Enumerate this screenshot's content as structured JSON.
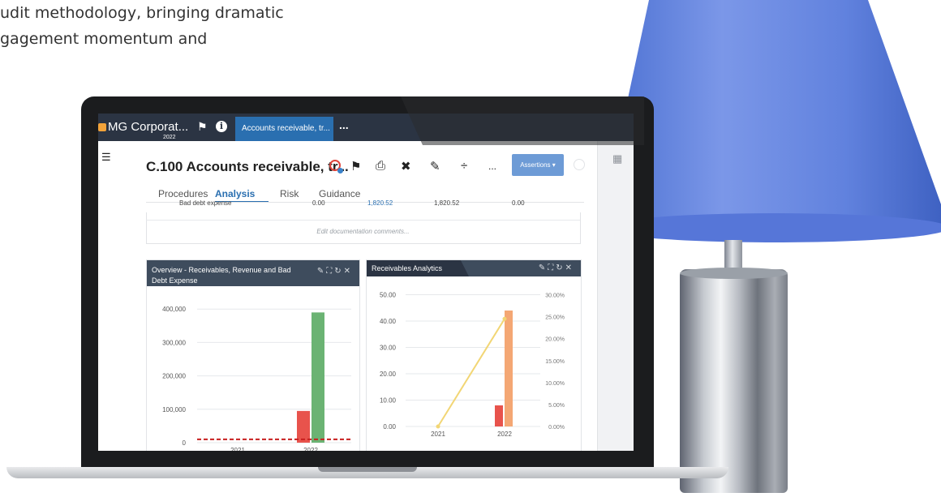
{
  "marketing": {
    "line1": "udit methodology, bringing dramatic",
    "line2": "gagement momentum and"
  },
  "topbar": {
    "org_name": "MG Corporat...",
    "org_year": "2022",
    "active_tab": "Accounts receivable, tr...",
    "more": "..."
  },
  "header": {
    "title": "C.100 Accounts receivable, tr...",
    "assertions_label": "Assertions ▾",
    "more_label": "..."
  },
  "tabs": [
    {
      "label": "Procedures"
    },
    {
      "label": "Analysis"
    },
    {
      "label": "Risk"
    },
    {
      "label": "Guidance"
    }
  ],
  "table_row": {
    "label": "Bad debt expense",
    "col1": "0.00",
    "col2": "1,820.52",
    "col3": "1,820.52",
    "col4": "0.00"
  },
  "doc_comments": "Edit documentation comments...",
  "panel1": {
    "title": "Overview - Receivables, Revenue and Bad Debt Expense",
    "chart_data": {
      "type": "bar",
      "categories": [
        "2021",
        "2022"
      ],
      "y_ticks": [
        "0",
        "100,000",
        "200,000",
        "300,000",
        "400,000"
      ],
      "ylim": [
        0,
        420000
      ],
      "series": [
        {
          "color": "#e8534c",
          "values": [
            0,
            95000
          ]
        },
        {
          "color": "#6bb373",
          "values": [
            0,
            390000
          ]
        }
      ],
      "reference_line": {
        "value": 10000,
        "color": "#c71f1f",
        "style": "dashed"
      }
    }
  },
  "panel2": {
    "title": "Receivables Analytics",
    "chart_data": {
      "type": "bar",
      "categories": [
        "2021",
        "2022"
      ],
      "y_ticks": [
        "0.00",
        "10.00",
        "20.00",
        "30.00",
        "40.00",
        "50.00"
      ],
      "y2_ticks": [
        "0.00%",
        "5.00%",
        "10.00%",
        "15.00%",
        "20.00%",
        "25.00%",
        "30.00%"
      ],
      "ylim": [
        0,
        52
      ],
      "y2lim": [
        0,
        0.312
      ],
      "series": [
        {
          "color": "#e8534c",
          "values": [
            0,
            8
          ]
        },
        {
          "color": "#f4a774",
          "values": [
            0,
            44
          ]
        }
      ],
      "line": {
        "color": "#f2d675",
        "values": [
          0,
          0.245
        ]
      }
    }
  }
}
